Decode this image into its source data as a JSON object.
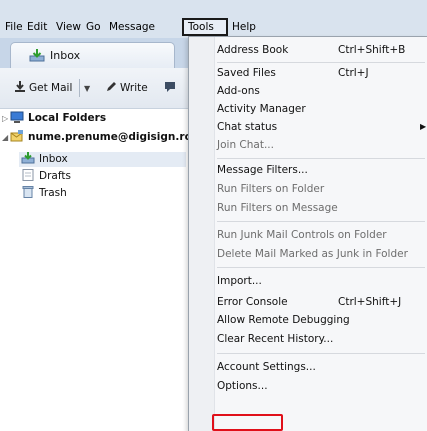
{
  "menubar": {
    "items": [
      {
        "label": "File"
      },
      {
        "label": "Edit"
      },
      {
        "label": "View"
      },
      {
        "label": "Go"
      },
      {
        "label": "Message"
      },
      {
        "label": "Tools"
      },
      {
        "label": "Help"
      }
    ]
  },
  "tab": {
    "label": "Inbox",
    "icon": "inbox-icon"
  },
  "toolbar": {
    "get_mail": "Get Mail",
    "write": "Write"
  },
  "folders": {
    "local_folders": "Local Folders",
    "account": "nume.prenume@digisign.ro",
    "inbox": "Inbox",
    "drafts": "Drafts",
    "trash": "Trash"
  },
  "tools_menu": {
    "address_book": {
      "label": "Address Book",
      "shortcut": "Ctrl+Shift+B"
    },
    "saved_files": {
      "label": "Saved Files",
      "shortcut": "Ctrl+J"
    },
    "addons": {
      "label": "Add-ons"
    },
    "activity_manager": {
      "label": "Activity Manager"
    },
    "chat_status": {
      "label": "Chat status"
    },
    "join_chat": {
      "label": "Join Chat..."
    },
    "message_filters": {
      "label": "Message Filters..."
    },
    "run_filters_folder": {
      "label": "Run Filters on Folder"
    },
    "run_filters_message": {
      "label": "Run Filters on Message"
    },
    "run_junk": {
      "label": "Run Junk Mail Controls on Folder"
    },
    "delete_junk": {
      "label": "Delete Mail Marked as Junk in Folder"
    },
    "import": {
      "label": "Import..."
    },
    "error_console": {
      "label": "Error Console",
      "shortcut": "Ctrl+Shift+J"
    },
    "remote_debugging": {
      "label": "Allow Remote Debugging"
    },
    "clear_history": {
      "label": "Clear Recent History..."
    },
    "account_settings": {
      "label": "Account Settings..."
    },
    "options": {
      "label": "Options..."
    }
  },
  "colors": {
    "highlight_box": "#e0101a",
    "menubar_bg": "#d9e3ee"
  }
}
